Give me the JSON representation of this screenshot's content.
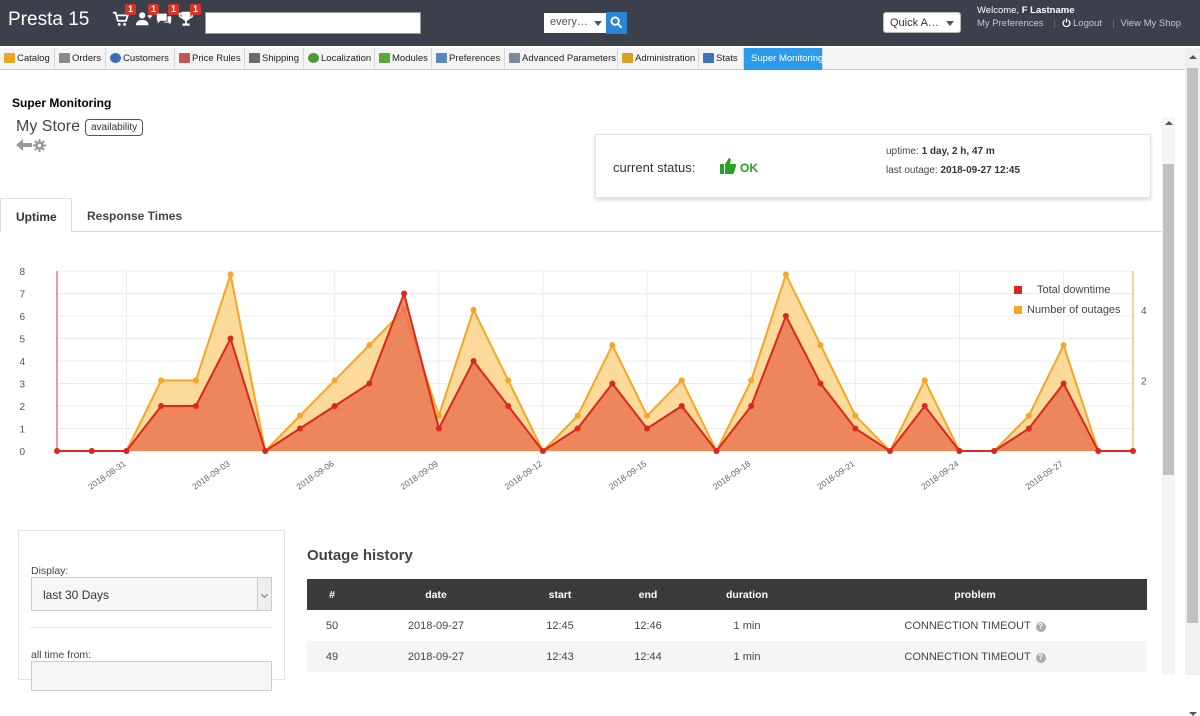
{
  "header": {
    "shop_name": "Presta 15",
    "notifications": [
      {
        "icon": "cart-icon",
        "count": "1"
      },
      {
        "icon": "new-customer-icon",
        "count": "1"
      },
      {
        "icon": "messages-icon",
        "count": "1"
      },
      {
        "icon": "trophy-icon",
        "count": "1"
      }
    ],
    "search": {
      "value": "",
      "scope": "every…"
    },
    "quick_access": "Quick A…",
    "welcome_prefix": "Welcome,",
    "user_name": "F Lastname",
    "my_preferences": "My Preferences",
    "logout": "Logout",
    "view_shop": "View My Shop"
  },
  "menu": [
    {
      "label": "Catalog",
      "icon": "catalog-icon",
      "color": "#e8a822"
    },
    {
      "label": "Orders",
      "icon": "orders-icon",
      "color": "#8a8a8a"
    },
    {
      "label": "Customers",
      "icon": "customers-icon",
      "color": "#3a6fb0"
    },
    {
      "label": "Price Rules",
      "icon": "price-rules-icon",
      "color": "#c2574f"
    },
    {
      "label": "Shipping",
      "icon": "shipping-icon",
      "color": "#6b6b6b"
    },
    {
      "label": "Localization",
      "icon": "localization-icon",
      "color": "#4a9a3c"
    },
    {
      "label": "Modules",
      "icon": "modules-icon",
      "color": "#5da43a"
    },
    {
      "label": "Preferences",
      "icon": "preferences-icon",
      "color": "#5a86b8"
    },
    {
      "label": "Advanced Parameters",
      "icon": "advanced-parameters-icon",
      "color": "#7c87a0"
    },
    {
      "label": "Administration",
      "icon": "administration-icon",
      "color": "#d7a21f"
    },
    {
      "label": "Stats",
      "icon": "stats-icon",
      "color": "#3b74c4"
    },
    {
      "label": "Super Monitoring",
      "icon": "",
      "color": "#2a9bea"
    }
  ],
  "page": {
    "heading": "Super Monitoring",
    "store_name": "My Store",
    "store_tag": "availability"
  },
  "status": {
    "label": "current status:",
    "value": "OK",
    "uptime_label": "uptime:",
    "uptime_value": "1 day, 2 h, 47 m",
    "outage_label": "last outage:",
    "outage_value": "2018-09-27 12:45",
    "ok_color": "#26a225"
  },
  "tabs": [
    {
      "label": "Uptime",
      "active": true
    },
    {
      "label": "Response Times",
      "active": false
    }
  ],
  "chart_data": {
    "type": "area",
    "x": [
      "2018-08-29",
      "2018-08-30",
      "2018-08-31",
      "2018-09-01",
      "2018-09-02",
      "2018-09-03",
      "2018-09-04",
      "2018-09-05",
      "2018-09-06",
      "2018-09-07",
      "2018-09-08",
      "2018-09-09",
      "2018-09-10",
      "2018-09-11",
      "2018-09-12",
      "2018-09-13",
      "2018-09-14",
      "2018-09-15",
      "2018-09-16",
      "2018-09-17",
      "2018-09-18",
      "2018-09-19",
      "2018-09-20",
      "2018-09-21",
      "2018-09-22",
      "2018-09-23",
      "2018-09-24",
      "2018-09-25",
      "2018-09-26",
      "2018-09-27",
      "2018-09-28",
      "2018-09-29"
    ],
    "x_ticks": [
      "2018-08-31",
      "2018-09-03",
      "2018-09-06",
      "2018-09-09",
      "2018-09-12",
      "2018-09-15",
      "2018-09-18",
      "2018-09-21",
      "2018-09-24",
      "2018-09-27"
    ],
    "series": [
      {
        "name": "Total downtime",
        "axis": "left",
        "color": "#d9281f",
        "values": [
          0,
          0,
          0,
          2,
          2,
          5,
          0,
          1,
          2,
          3,
          7,
          1,
          4,
          2,
          0,
          1,
          3,
          1,
          2,
          0,
          2,
          6,
          3,
          1,
          0,
          2,
          0,
          0,
          1,
          3,
          0,
          0
        ]
      },
      {
        "name": "Number of outages",
        "axis": "right",
        "color": "#f5a623",
        "values": [
          0,
          0,
          0,
          2,
          2,
          5,
          0,
          1,
          2,
          3,
          4,
          1,
          4,
          2,
          0,
          1,
          3,
          1,
          2,
          0,
          2,
          5,
          3,
          1,
          0,
          2,
          0,
          0,
          1,
          3,
          0,
          0
        ]
      }
    ],
    "y_left": {
      "min": 0,
      "max": 8,
      "ticks": [
        "0",
        "1",
        "2",
        "3",
        "4",
        "5",
        "6",
        "7",
        "8"
      ]
    },
    "y_right": {
      "min": 0,
      "max": 5.1,
      "ticks": [
        "2",
        "4"
      ]
    },
    "legend_position": "top-right",
    "grid": true
  },
  "filters": {
    "display_label": "Display:",
    "display_value": "last 30 Days",
    "alltime_label": "all time from:"
  },
  "outages": {
    "title": "Outage history",
    "columns": [
      "#",
      "date",
      "start",
      "end",
      "duration",
      "problem"
    ],
    "rows": [
      {
        "num": "50",
        "date": "2018-09-27",
        "start": "12:45",
        "end": "12:46",
        "duration": "1 min",
        "problem": "CONNECTION TIMEOUT"
      },
      {
        "num": "49",
        "date": "2018-09-27",
        "start": "12:43",
        "end": "12:44",
        "duration": "1 min",
        "problem": "CONNECTION TIMEOUT"
      }
    ]
  }
}
